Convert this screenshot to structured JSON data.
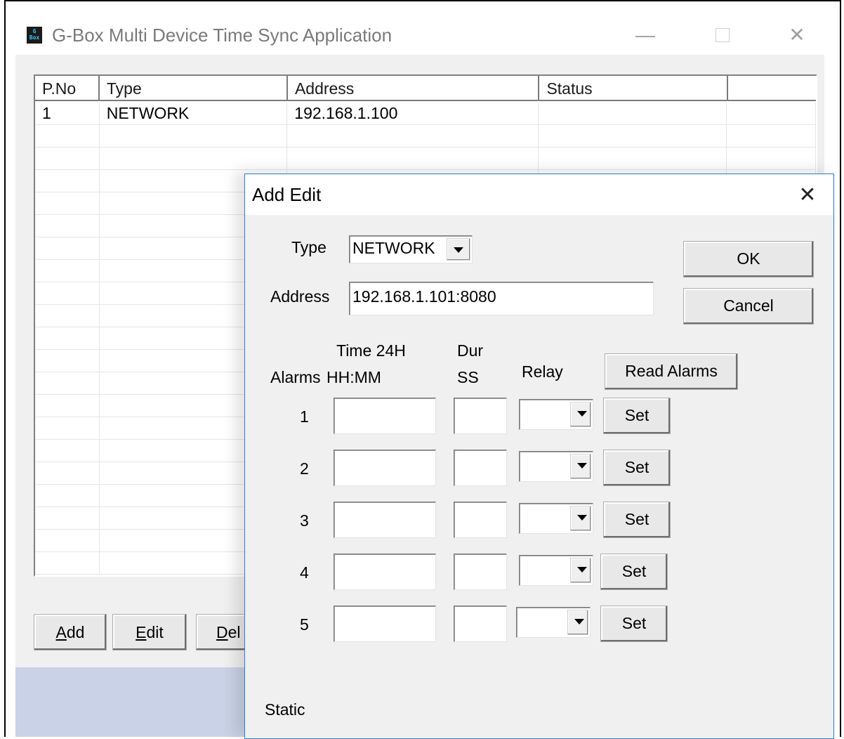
{
  "main": {
    "title": "G-Box Multi Device Time Sync Application",
    "icon_text": "G Box",
    "window_controls": {
      "minimize": "—",
      "close": "✕"
    },
    "grid": {
      "headers": [
        "P.No",
        "Type",
        "Address",
        "Status",
        ""
      ],
      "rows": [
        [
          "1",
          "NETWORK",
          "192.168.1.100",
          "",
          ""
        ]
      ]
    },
    "buttons": {
      "add_underline": "A",
      "add_rest": "dd",
      "edit_underline": "E",
      "edit_rest": "dit",
      "del_underline": "D",
      "del_rest": "el"
    }
  },
  "dialog": {
    "title": "Add Edit",
    "close": "✕",
    "type_label": "Type",
    "type_value": "NETWORK",
    "address_label": "Address",
    "address_value": "192.168.1.101:8080",
    "ok_label": "OK",
    "cancel_label": "Cancel",
    "alarms_label": "Alarms",
    "time_header_line1": "Time 24H",
    "time_header_line2": "HH:MM",
    "dur_header_line1": "Dur",
    "dur_header_line2": "SS",
    "relay_header": "Relay",
    "read_alarms_label": "Read Alarms",
    "alarms": [
      {
        "num": "1",
        "time": "",
        "dur": "",
        "relay": "",
        "set_label": "Set"
      },
      {
        "num": "2",
        "time": "",
        "dur": "",
        "relay": "",
        "set_label": "Set"
      },
      {
        "num": "3",
        "time": "",
        "dur": "",
        "relay": "",
        "set_label": "Set"
      },
      {
        "num": "4",
        "time": "",
        "dur": "",
        "relay": "",
        "set_label": "Set"
      },
      {
        "num": "5",
        "time": "",
        "dur": "",
        "relay": "",
        "set_label": "Set"
      }
    ],
    "status_text": "Static"
  }
}
